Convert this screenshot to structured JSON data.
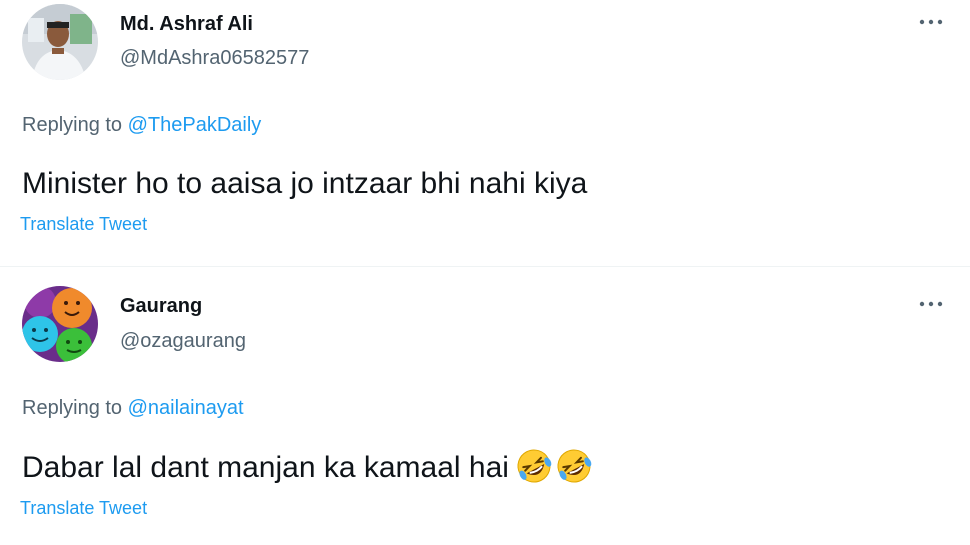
{
  "tweets": [
    {
      "display_name": "Md. Ashraf Ali",
      "handle": "@MdAshra06582577",
      "replying_prefix": "Replying to",
      "replying_to": "@ThePakDaily",
      "text": "Minister ho to aaisa jo intzaar bhi nahi kiya",
      "translate_label": "Translate Tweet",
      "more_icon": "more-horizontal-icon"
    },
    {
      "display_name": "Gaurang",
      "handle": "@ozagaurang",
      "replying_prefix": "Replying to",
      "replying_to": "@nailainayat",
      "text": "Dabar lal dant manjan ka kamaal hai",
      "emoji": [
        "rolling-on-floor-laughing",
        "rolling-on-floor-laughing"
      ],
      "translate_label": "Translate Tweet",
      "more_icon": "more-horizontal-icon"
    }
  ],
  "colors": {
    "text_primary": "#0f1419",
    "text_secondary": "#536471",
    "link": "#1d9bf0",
    "divider": "#eff3f4"
  }
}
